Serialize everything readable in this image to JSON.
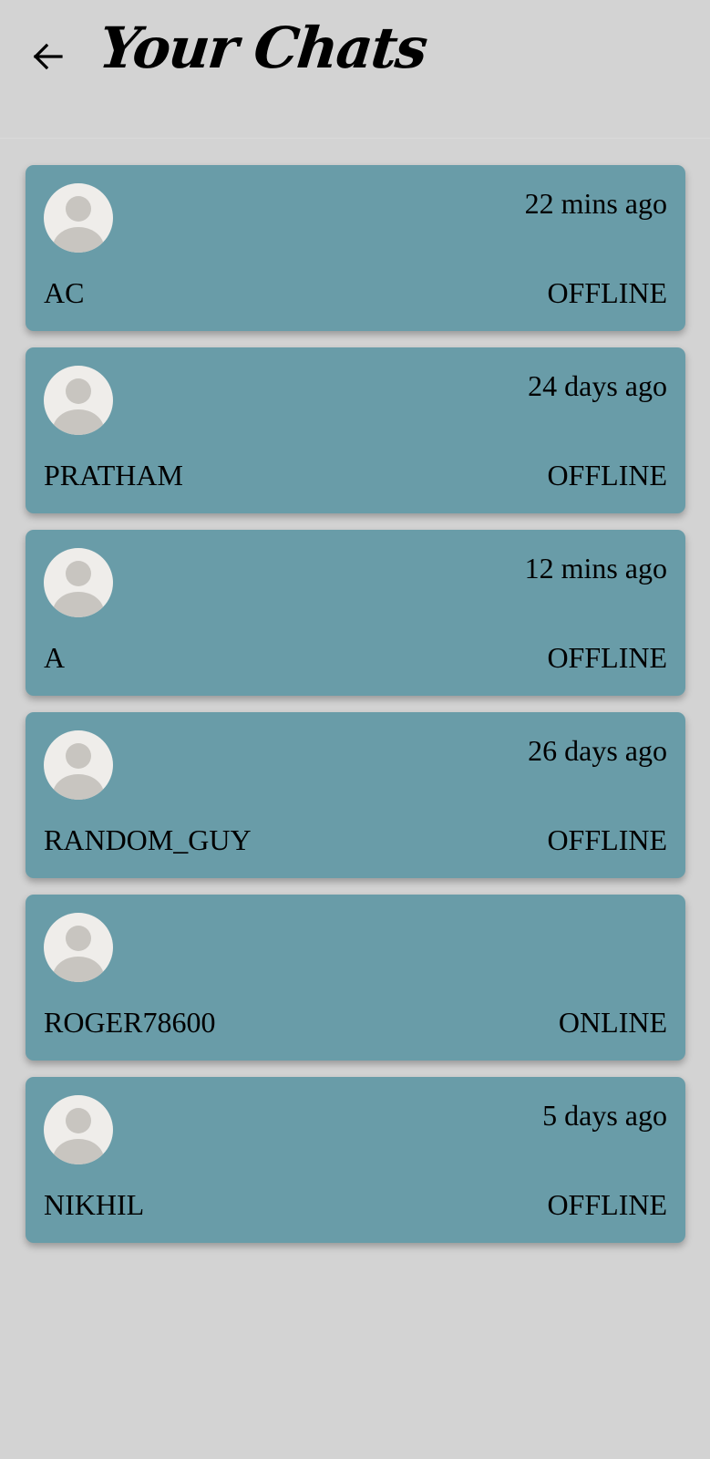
{
  "header": {
    "title": "Your Chats",
    "back_icon": "arrow-left-icon"
  },
  "chats": [
    {
      "name": "AC",
      "last_seen": "22 mins ago",
      "status": "OFFLINE",
      "avatar_icon": "default-user-avatar-icon"
    },
    {
      "name": "PRATHAM",
      "last_seen": "24 days ago",
      "status": "OFFLINE",
      "avatar_icon": "default-user-avatar-icon"
    },
    {
      "name": "A",
      "last_seen": "12 mins ago",
      "status": "OFFLINE",
      "avatar_icon": "default-user-avatar-icon"
    },
    {
      "name": "RANDOM_GUY",
      "last_seen": "26 days ago",
      "status": "OFFLINE",
      "avatar_icon": "default-user-avatar-icon"
    },
    {
      "name": "ROGER78600",
      "last_seen": "",
      "status": "ONLINE",
      "avatar_icon": "default-user-avatar-icon"
    },
    {
      "name": "NIKHIL",
      "last_seen": "5 days ago",
      "status": "OFFLINE",
      "avatar_icon": "default-user-avatar-icon"
    }
  ],
  "colors": {
    "background": "#d3d3d3",
    "card": "#699ca8",
    "avatar_bg": "#efedea",
    "avatar_figure": "#c8c5c0",
    "text": "#000000"
  }
}
